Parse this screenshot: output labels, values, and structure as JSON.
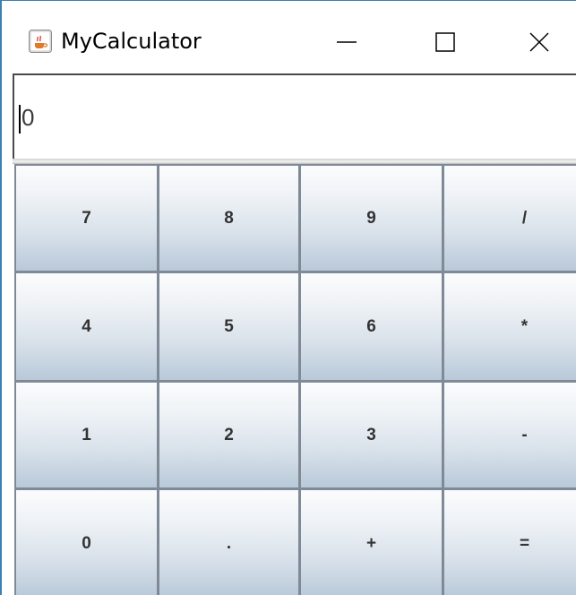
{
  "window": {
    "title": "MyCalculator",
    "icon": "java-cup-icon",
    "controls": [
      "minimize-icon",
      "maximize-icon",
      "close-icon"
    ]
  },
  "display": {
    "value": "0"
  },
  "keypad": {
    "rows": [
      [
        "7",
        "8",
        "9",
        "/"
      ],
      [
        "4",
        "5",
        "6",
        "*"
      ],
      [
        "1",
        "2",
        "3",
        "-"
      ],
      [
        "0",
        ".",
        "+",
        "="
      ]
    ]
  },
  "colors": {
    "window_border": "#3c7fb1",
    "button_top": "#fbfcfd",
    "button_bottom": "#b9c9d9",
    "button_border": "#7f8a96",
    "button_text": "#333333"
  }
}
